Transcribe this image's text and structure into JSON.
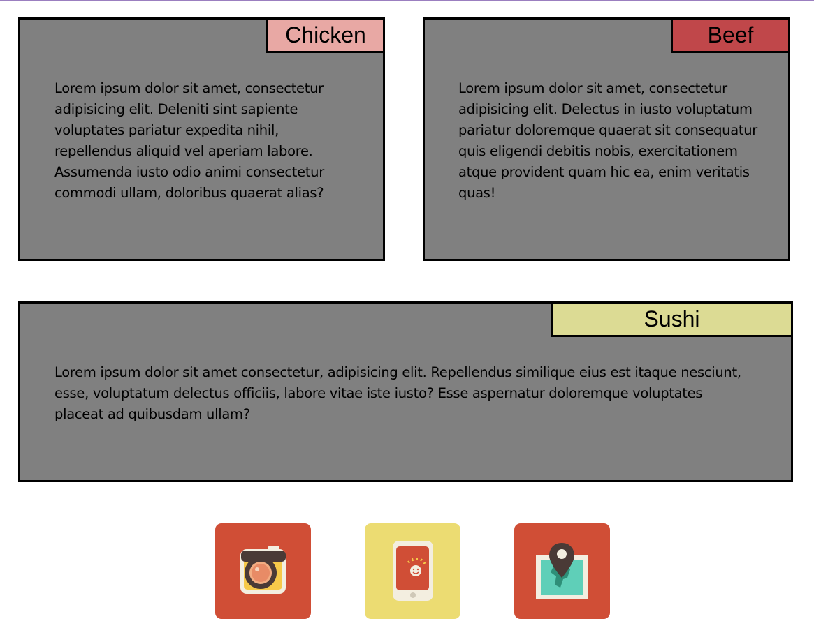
{
  "cards": [
    {
      "tag": "Chicken",
      "tag_color": "#e8a8a4",
      "text": "Lorem ipsum dolor sit amet, consectetur adipisicing elit. Deleniti sint sapiente voluptates pariatur expedita nihil, repellendus aliquid vel aperiam labore. Assumenda iusto odio animi consectetur commodi ullam, doloribus quaerat alias?"
    },
    {
      "tag": "Beef",
      "tag_color": "#c0474a",
      "text": "Lorem ipsum dolor sit amet, consectetur adipisicing elit. Delectus in iusto voluptatum pariatur doloremque quaerat sit consequatur quis eligendi debitis nobis, exercitationem atque provident quam hic ea, enim veritatis quas!"
    },
    {
      "tag": "Sushi",
      "tag_color": "#dcdb94",
      "text": "Lorem ipsum dolor sit amet consectetur, adipisicing elit. Repellendus similique eius est itaque nesciunt, esse, voluptatum delectus officiis, labore vitae iste iusto? Esse aspernatur doloremque voluptates placeat ad quibusdam ullam?"
    }
  ],
  "icons": [
    {
      "name": "camera-icon",
      "tile_color": "#d04e36"
    },
    {
      "name": "phone-icon",
      "tile_color": "#ecdc72"
    },
    {
      "name": "map-pin-icon",
      "tile_color": "#d04e36"
    }
  ],
  "colors": {
    "card_background": "#808080",
    "card_border": "#000000",
    "page_background": "#ffffff"
  }
}
